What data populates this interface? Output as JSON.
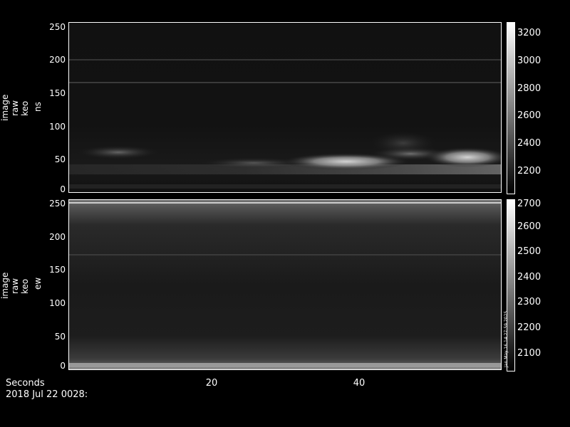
{
  "chart_data": [
    {
      "type": "heatmap",
      "ylabel": [
        "image",
        "raw",
        "keo",
        "ns"
      ],
      "yticks": [
        0,
        50,
        100,
        150,
        200,
        250
      ],
      "ylim": [
        0,
        256
      ],
      "xlim": [
        0,
        60
      ],
      "colorbar": {
        "ticks": [
          2200,
          2400,
          2600,
          2800,
          3000,
          3200
        ],
        "range": [
          2050,
          3300
        ]
      }
    },
    {
      "type": "heatmap",
      "ylabel": [
        "image",
        "raw",
        "keo",
        "ew"
      ],
      "yticks": [
        0,
        50,
        100,
        150,
        200,
        250
      ],
      "ylim": [
        0,
        256
      ],
      "xlim": [
        0,
        60
      ],
      "colorbar": {
        "ticks": [
          2100,
          2200,
          2300,
          2400,
          2500,
          2600,
          2700
        ],
        "range": [
          2030,
          2715
        ]
      }
    }
  ],
  "xaxis": {
    "ticks": [
      20,
      40
    ],
    "label": "Seconds"
  },
  "footer": {
    "date": "2018 Jul 22 0028:"
  },
  "stamp": "Jan May 16 14:27:59 2025"
}
